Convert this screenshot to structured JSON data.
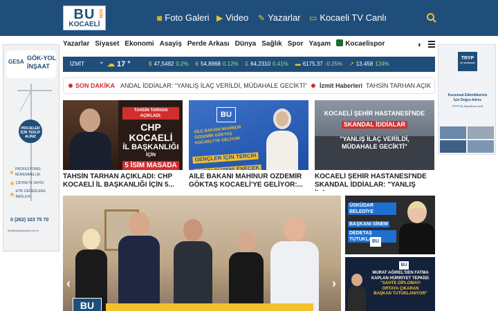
{
  "header": {
    "logo_bu": "BU",
    "logo_gun": "GÜN",
    "logo_city": "KOCAELİ",
    "nav": [
      {
        "label": "Foto Galeri",
        "icon": "camera-icon"
      },
      {
        "label": "Video",
        "icon": "video-icon"
      },
      {
        "label": "Yazarlar",
        "icon": "pen-icon"
      },
      {
        "label": "Kocaeli TV Canlı",
        "icon": "tv-icon"
      }
    ]
  },
  "secondary_nav": [
    "Yazarlar",
    "Siyaset",
    "Ekonomi",
    "Asayiş",
    "Perde Arkası",
    "Dünya",
    "Sağlık",
    "Spor",
    "Yaşam",
    "Kocaelispor"
  ],
  "ticker": {
    "city": "İZMİT",
    "temp": "17",
    "temp_unit": "°",
    "items": [
      {
        "symbol": "$",
        "value": "47,5492",
        "change": "0.2%"
      },
      {
        "symbol": "€",
        "value": "54,8968",
        "change": "0.12%"
      },
      {
        "symbol": "£",
        "value": "64,2310",
        "change": "0.41%"
      },
      {
        "symbol": "",
        "value": "6175.37",
        "change": "-0.25%"
      },
      {
        "symbol": "",
        "value": "13.458",
        "change": "124%"
      }
    ]
  },
  "breaking": {
    "label": "SON DAKİKA",
    "text1": "ANDAL İDDİALAR: \"YANLIŞ İLAÇ VERİLDİ, MÜDAHALE GECİKTİ\"",
    "cat": "İzmit Haberleri",
    "text2": "TAHSİN TARHAN AÇIK"
  },
  "cards": [
    {
      "title": "TAHSİN TARHAN AÇIKLADI: CHP KOCAELİ İL BAŞKANLIĞI İÇİN 5...",
      "img_l1": "TAHSİN TARHAN AÇIKLADI:",
      "img_l2": "CHP KOCAELİ",
      "img_l3": "İL BAŞKANLIĞI",
      "img_l4": "İÇİN",
      "img_l5": "5 İSİM MASADA"
    },
    {
      "title": "AİLE BAKANI MAHİNUR ÖZDEMİR GÖKTAŞ KOCAELİ'YE GELİYOR:...",
      "img_l1": "AİLE BAKANI MAHİNUR",
      "img_l2": "ÖZDEMİR GÖKTAŞ",
      "img_l3": "KOCAELİ'YE GELİYOR",
      "img_l4": "GENÇLER İÇİN TERCİH",
      "img_l5": "FUARI DÜZENLENECEK"
    },
    {
      "title": "KOCAELİ ŞEHİR HASTANESİ'NDE SKANDAL İDDİALAR: \"YANLIŞ İLA...",
      "img_l1": "KOCAELİ ŞEHİR HASTANESİ'NDE",
      "img_l2": "SKANDAL İDDİALAR",
      "img_l3": "\"YANLIŞ İLAÇ VERİLDİ,",
      "img_l4": "MÜDAHALE GECİKTİ\""
    }
  ],
  "side_news": [
    {
      "l1": "ÜSKÜDAR BELEDİYE",
      "l2": "BAŞKANI SİNEM",
      "l3": "DEDETAŞ TUTUKLANDI"
    },
    {
      "l1": "MURAT AĞIREL'DEN FATMA",
      "l2": "KAPLAN HÜRRİYET TEPKİSİ:",
      "l3": "\"SAHTE DİPLOMAYI",
      "l4": "ORTAYA ÇIKARAN",
      "l5": "BAŞKAN TUTUKLANIYOR\""
    }
  ],
  "ad_left": {
    "brand1": "GÖK-YOL",
    "brand2": "İNŞAAT",
    "brand_short": "GESA",
    "badge": "PROJELER İÇİN TEKLİF ALINIZ",
    "b1": "PROFESYONEL MÜKEMMELLİK",
    "b2": "ÇEVREYE SAYGI",
    "b3": "ETİK DEĞERLERE BAĞLILIK",
    "phone": "0 (262) 323 75 70",
    "web": "info@gokyolinsaat.com.tr"
  },
  "ad_right": {
    "brand": "TRYP",
    "sub": "BY WYNDHAM",
    "l1": "Kurumsal Etkinlikleriniz",
    "l2": "İçin Doğru Adres",
    "l3": "TRYP By Wyndham İzmit"
  },
  "slider_logo": "BU"
}
